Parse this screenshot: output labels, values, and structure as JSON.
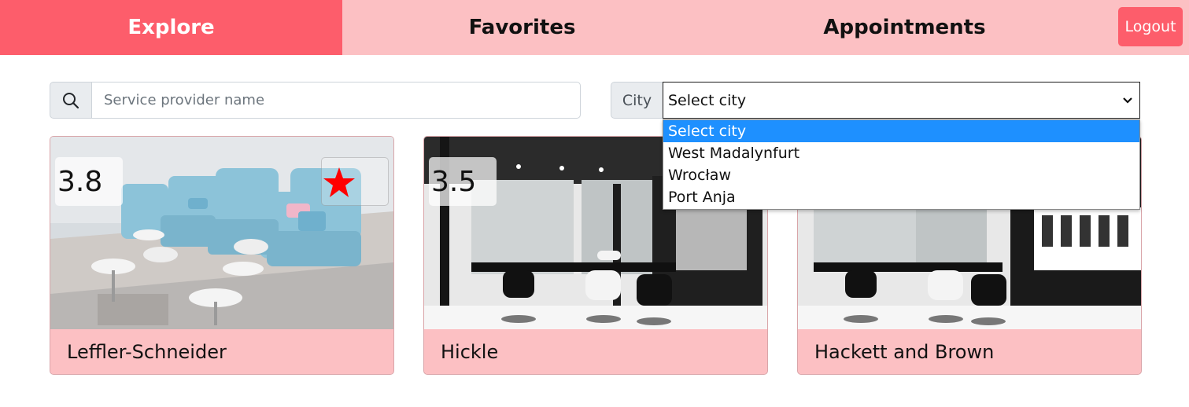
{
  "nav": {
    "tabs": [
      {
        "label": "Explore",
        "active": true
      },
      {
        "label": "Favorites",
        "active": false
      },
      {
        "label": "Appointments",
        "active": false
      }
    ],
    "logout_label": "Logout",
    "accent_color": "#fd5d6b",
    "bar_color": "#fcc0c3"
  },
  "search": {
    "icon": "search-icon",
    "placeholder": "Service provider name",
    "value": ""
  },
  "city": {
    "label": "City",
    "selected": "Select city",
    "options": [
      "Select city",
      "West Madalynfurt",
      "Wrocław",
      "Port Anja"
    ],
    "highlighted_index": 0
  },
  "providers": [
    {
      "name": "Leffler-Schneider",
      "rating": "3.8",
      "favorite": true
    },
    {
      "name": "Hickle",
      "rating": "3.5",
      "favorite": false
    },
    {
      "name": "Hackett and Brown",
      "rating": "",
      "favorite": false
    }
  ]
}
